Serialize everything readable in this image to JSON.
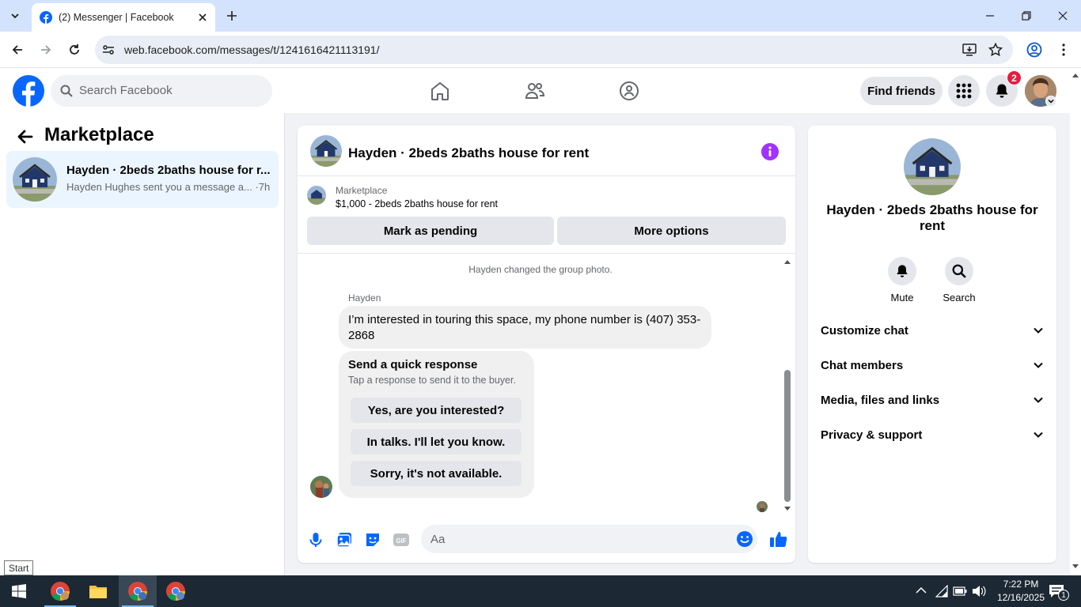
{
  "browser": {
    "tab_title": "(2) Messenger | Facebook",
    "url": "web.facebook.com/messages/t/1241616421113191/"
  },
  "fb_header": {
    "search_placeholder": "Search Facebook",
    "find_friends": "Find friends",
    "notification_count": "2"
  },
  "left_pane": {
    "title": "Marketplace",
    "conversation": {
      "name": "Hayden · 2beds 2baths house for r...",
      "preview": "Hayden Hughes sent you a message a... ·7h"
    }
  },
  "chat": {
    "title": "Hayden · 2beds 2baths house for rent",
    "marketplace_label": "Marketplace",
    "listing": "$1,000 - 2beds 2baths house for rent",
    "mark_pending": "Mark as pending",
    "more_options": "More options",
    "system_message": "Hayden changed the group photo.",
    "sender": "Hayden",
    "message": "I’m interested in touring this space, my phone number is (407) 353-2868",
    "quick_response": {
      "heading": "Send a quick response",
      "subtext": "Tap a response to send it to the buyer.",
      "options": [
        "Yes, are you interested?",
        "In talks. I'll let you know.",
        "Sorry, it's not available."
      ]
    },
    "composer_placeholder": "Aa"
  },
  "right_pane": {
    "name": "Hayden · 2beds 2baths house for rent",
    "mute": "Mute",
    "search": "Search",
    "sections": [
      "Customize chat",
      "Chat members",
      "Media, files and links",
      "Privacy & support"
    ]
  },
  "tooltip": "Start",
  "taskbar": {
    "time": "7:22 PM",
    "date": "12/16/2025",
    "notif_count": "1"
  },
  "colors": {
    "fb_blue": "#0866ff",
    "messenger_purple": "#a033ff",
    "badge_red": "#e41e3f"
  }
}
